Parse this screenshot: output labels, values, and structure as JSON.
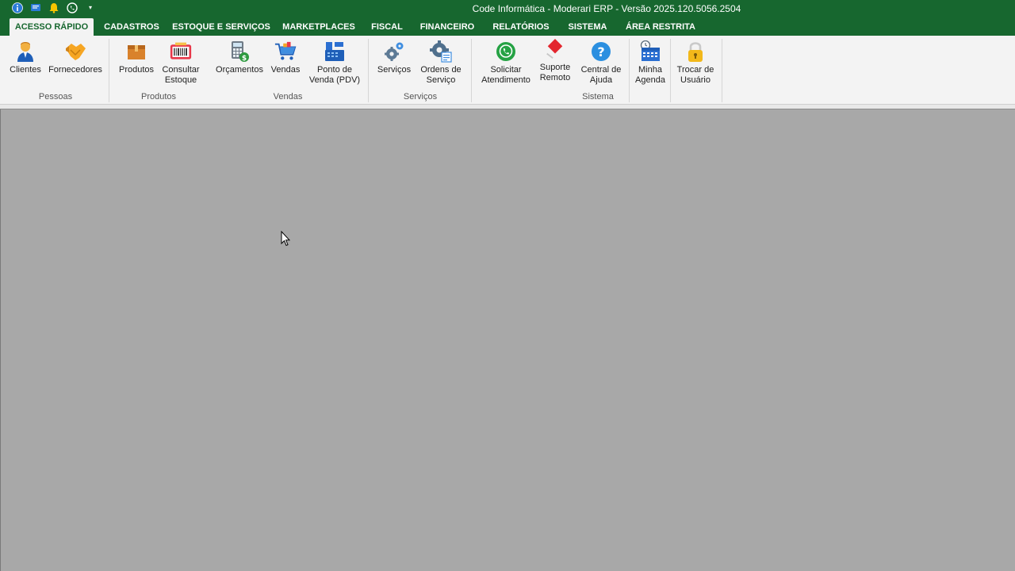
{
  "window": {
    "title": "Code Informática - Moderari ERP - Versão 2025.120.5056.2504"
  },
  "qat": {
    "icons": [
      "info-icon",
      "message-icon",
      "bell-icon",
      "whatsapp-icon"
    ],
    "more_label": "▾"
  },
  "tabs": [
    "ACESSO RÁPIDO",
    "CADASTROS",
    "ESTOQUE E SERVIÇOS",
    "MARKETPLACES",
    "FISCAL",
    "FINANCEIRO",
    "RELATÓRIOS",
    "SISTEMA",
    "ÁREA RESTRITA"
  ],
  "active_tab": "ACESSO RÁPIDO",
  "groups": {
    "pessoas": {
      "label": "Pessoas",
      "buttons": {
        "clientes": "Clientes",
        "fornecedores": "Fornecedores"
      }
    },
    "produtos": {
      "label": "Produtos",
      "buttons": {
        "produtos": "Produtos",
        "consultar_estoque": "Consultar Estoque"
      }
    },
    "vendas": {
      "label": "Vendas",
      "buttons": {
        "orcamentos": "Orçamentos",
        "vendas": "Vendas",
        "pdv": "Ponto de Venda (PDV)"
      }
    },
    "servicos": {
      "label": "Serviços",
      "buttons": {
        "servicos": "Serviços",
        "ordens": "Ordens de Serviço"
      }
    },
    "sistema": {
      "label": "Sistema",
      "buttons": {
        "solicitar": "Solicitar Atendimento",
        "suporte": "Suporte Remoto",
        "central": "Central de Ajuda",
        "agenda": "Minha Agenda",
        "trocar": "Trocar de Usuário"
      }
    }
  },
  "colors": {
    "brand_green": "#17672f",
    "ribbon_bg": "#f3f3f3",
    "workspace": "#a8a8a8"
  }
}
